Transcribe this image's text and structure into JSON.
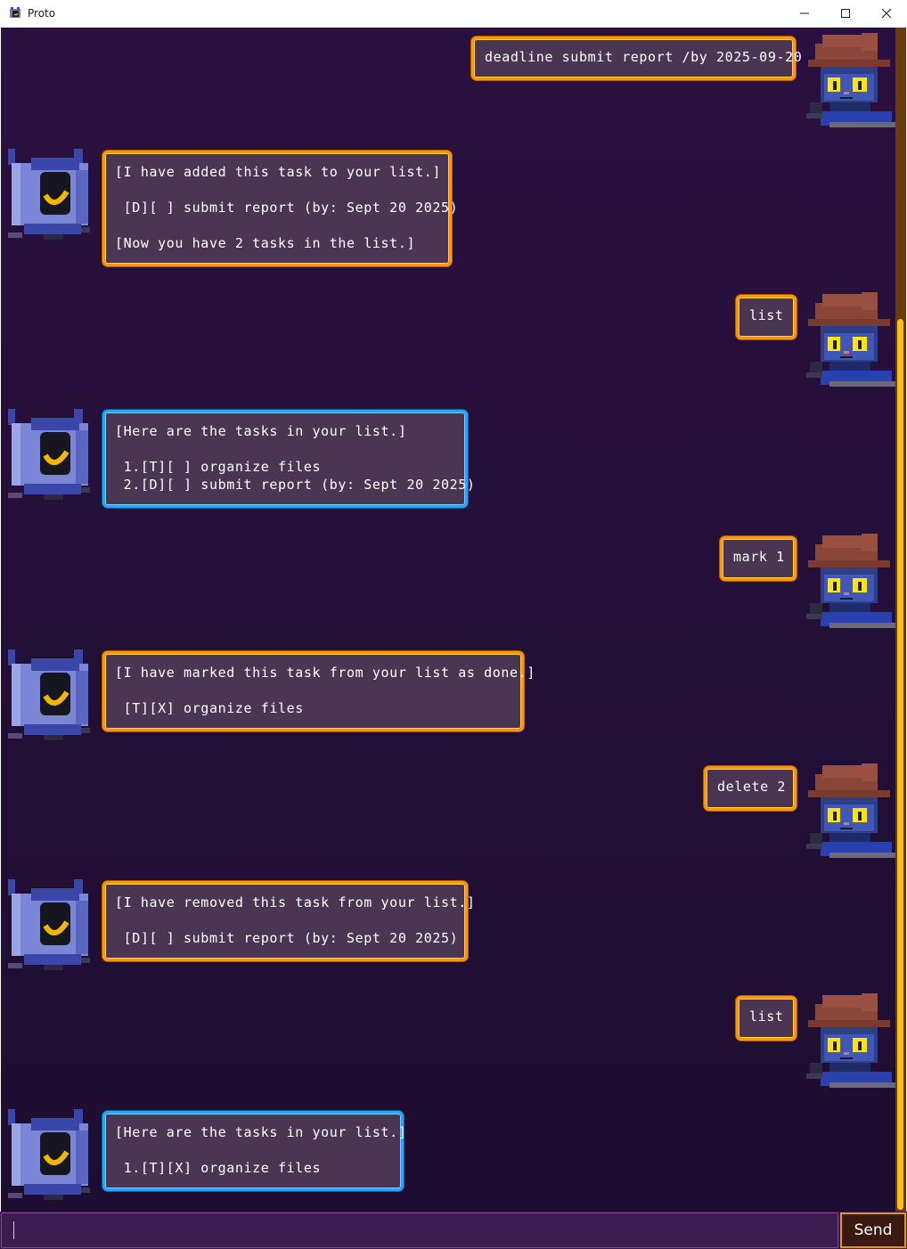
{
  "window": {
    "title": "Proto",
    "controls": {
      "minimize_icon": "minimize-icon",
      "maximize_icon": "maximize-icon",
      "close_icon": "close-icon"
    }
  },
  "colors": {
    "background": "#241038",
    "bubble_fill": "#4a3552",
    "bubble_border_orange": "#ff9800",
    "bubble_border_blue": "#1ea8ff",
    "scrollbar_thumb": "#ffc107",
    "send_border": "#e09a1a"
  },
  "messages": [
    {
      "sender": "user",
      "text": "deadline submit report /by 2025-09-20"
    },
    {
      "sender": "bot",
      "style": "orange",
      "text": "[I have added this task to your list.]\n\n [D][ ] submit report (by: Sept 20 2025)\n\n[Now you have 2 tasks in the list.]"
    },
    {
      "sender": "user",
      "text": "list"
    },
    {
      "sender": "bot",
      "style": "blue",
      "text": "[Here are the tasks in your list.]\n\n 1.[T][ ] organize files\n 2.[D][ ] submit report (by: Sept 20 2025)"
    },
    {
      "sender": "user",
      "text": "mark 1"
    },
    {
      "sender": "bot",
      "style": "orange",
      "text": "[I have marked this task from your list as done.]\n\n [T][X] organize files"
    },
    {
      "sender": "user",
      "text": "delete 2"
    },
    {
      "sender": "bot",
      "style": "orange",
      "text": "[I have removed this task from your list.]\n\n [D][ ] submit report (by: Sept 20 2025)"
    },
    {
      "sender": "user",
      "text": "list"
    },
    {
      "sender": "bot",
      "style": "blue",
      "text": "[Here are the tasks in your list.]\n\n 1.[T][X] organize files"
    }
  ],
  "input": {
    "value": "",
    "placeholder": ""
  },
  "send_button": {
    "label": "Send"
  }
}
